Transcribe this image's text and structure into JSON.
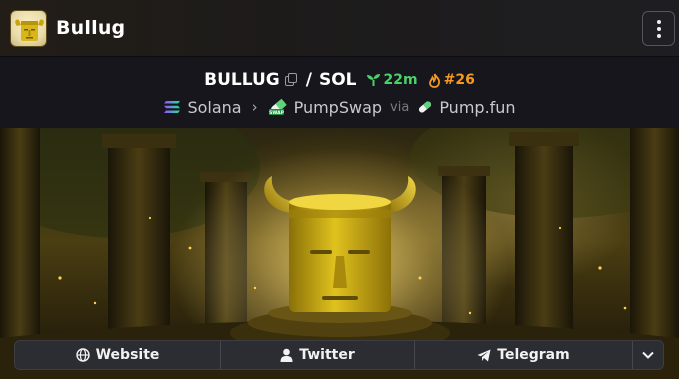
{
  "header": {
    "token_name": "Bullug",
    "logo_icon": "bull-head-logo",
    "menu_icon": "vertical-ellipsis-icon"
  },
  "pair": {
    "base_symbol": "BULLUG",
    "separator": "/",
    "quote_symbol": "SOL",
    "age": "22m",
    "age_icon": "seedling-icon",
    "rank": "#26",
    "rank_icon": "flame-icon"
  },
  "route": {
    "chain": "Solana",
    "chain_icon": "solana-icon",
    "dex": "PumpSwap",
    "dex_icon": "pumpswap-icon",
    "via": "via",
    "launchpad": "Pump.fun",
    "launchpad_icon": "pill-icon"
  },
  "socials": [
    {
      "label": "Website",
      "icon": "globe-icon"
    },
    {
      "label": "Twitter",
      "icon": "user-icon"
    },
    {
      "label": "Telegram",
      "icon": "paper-plane-icon"
    }
  ],
  "more_icon": "chevron-down-icon",
  "colors": {
    "age_green": "#4bd16b",
    "rank_orange": "#f59a23",
    "gold": "#d4b21c"
  }
}
